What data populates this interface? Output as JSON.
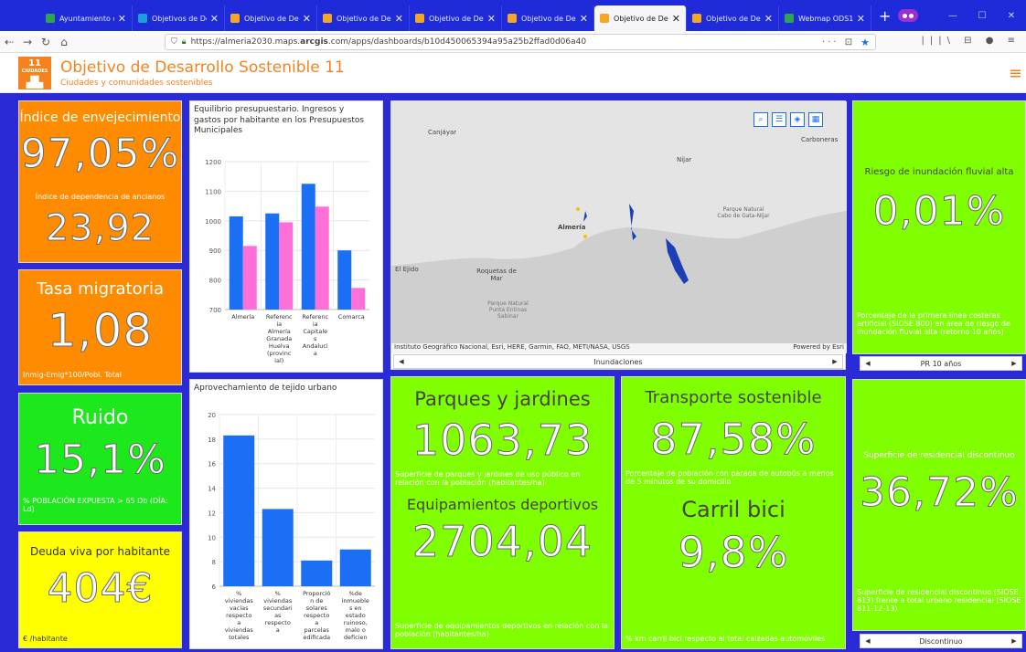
{
  "browser": {
    "tabs": [
      {
        "label": "Ayuntamiento d",
        "icon_color": "#2ea44f",
        "active": false
      },
      {
        "label": "Objetivos de De",
        "icon_color": "#1a9fd9",
        "active": false
      },
      {
        "label": "Objetivo de Des",
        "icon_color": "#f5a623",
        "active": false
      },
      {
        "label": "Objetivo de Des",
        "icon_color": "#f5a623",
        "active": false
      },
      {
        "label": "Objetivo de Des",
        "icon_color": "#f5a623",
        "active": false
      },
      {
        "label": "Objetivo de Des",
        "icon_color": "#f5a623",
        "active": false
      },
      {
        "label": "Objetivo de Des",
        "icon_color": "#f5a623",
        "active": true
      },
      {
        "label": "Objetivo de Des",
        "icon_color": "#f5a623",
        "active": false
      },
      {
        "label": "Webmap ODS1",
        "icon_color": "#2ea44f",
        "active": false
      }
    ],
    "url_prefix": "https://almeria2030.maps.",
    "url_bold": "arcgis",
    "url_suffix": ".com/apps/dashboards/b10d450065394a95a25b2ffad0d06a40",
    "page_actions": "··· ⊡",
    "right_icons": "|||\\ ⊟ ● ≡"
  },
  "header": {
    "title": "Objetivo de Desarrollo Sostenible 11",
    "subtitle": "Ciudades y comunidades sostenibles",
    "logo_num": "11",
    "logo_text": "CIUDADES"
  },
  "indicators": {
    "envejecimiento": {
      "title": "Índice de envejecimiento",
      "value": "97,05%",
      "sub_title": "Índice de dependencia de ancianos",
      "sub_value": "23,92"
    },
    "migratoria": {
      "title": "Tasa migratoria",
      "value": "1,08",
      "note": "Inmig-Emig*100/Pobl. Total"
    },
    "ruido": {
      "title": "Ruido",
      "value": "15,1%",
      "note": "% POBLACIÓN EXPUESTA > 65 Db (DÍA: Ld)"
    },
    "deuda": {
      "title": "Deuda viva por habitante",
      "value": "404€",
      "note": "€ /habitante"
    },
    "parques": {
      "title": "Parques y jardines",
      "value": "1063,73",
      "note": "Superficie de parques y jardines de uso público en relación con la población (habitantes/ha)"
    },
    "equipamientos": {
      "title": "Equipamientos deportivos",
      "value": "2704,04",
      "note": "Superficie de equipamientos deportivos en relación con la población (habitantes/ha)"
    },
    "transporte": {
      "title": "Transporte sostenible",
      "value": "87,58%",
      "note": "Porcentaje de población con parada de autobús a menos de 5 minutos de su domicilio"
    },
    "carril": {
      "title": "Carril bici",
      "value": "9,8%",
      "note": "% km carril bici respecto al total calzadas automóviles"
    },
    "inundacion": {
      "title": "Riesgo de inundación fluvial alta",
      "value": "0,01%",
      "note": "Porcentaje de la primera línea costeras artificial (SIOSE 800) en área de riesgo de inundación fluvial alta (retorno 10 años)",
      "selector": "PR 10 años"
    },
    "residencial": {
      "title": "Superficie de residencial discontinuo",
      "value": "36,72%",
      "note": "Superficie de residencial discontinuo (SIOSE 813) frente a total urbano residencial (SIOSE 811-12-13)",
      "selector": "Discontinuo"
    }
  },
  "map": {
    "labels": {
      "canjayar": "Canjáyar",
      "nijar": "Níjar",
      "carboneras": "Carboneras",
      "almeria": "Almería",
      "elejido": "El Ejido",
      "roquetas": "Roquetas de Mar",
      "parque": "Parque Natural Cabo de Gata-Níjar",
      "parque2": "Parque Natural Punta Entinas Sabinar"
    },
    "attribution": "Instituto Geográfico Nacional, Esri, HERE, Garmin, FAO, METI/NASA, USGS",
    "powered": "Powered by Esri",
    "selector": "Inundaciones"
  },
  "chart_data": [
    {
      "type": "bar",
      "title": "Equilibrio presupuestario. Ingresos y gastos por habitante en los Presupuestos Municipales",
      "categories": [
        "Almería",
        "Referencia Almería Granada Huelva (provincial)",
        "Referencia Capitales Andalucía",
        "Comarca"
      ],
      "category_lines": [
        [
          "Almería"
        ],
        [
          "Referenc",
          "ia",
          "Almería",
          "Granada",
          "Huelva",
          "(provinc",
          "ial)"
        ],
        [
          "Referenc",
          "ia",
          "Capitale",
          "s",
          "Andaluci",
          "a"
        ],
        [
          "Comarca"
        ]
      ],
      "series": [
        {
          "color": "#1a6ff5",
          "values": [
            1015,
            1025,
            1125,
            900
          ]
        },
        {
          "color": "#ff6fd8",
          "values": [
            915,
            995,
            1048,
            773
          ]
        }
      ],
      "ylim": [
        700,
        1200
      ],
      "yticks": [
        700,
        800,
        900,
        1000,
        1100,
        1200
      ],
      "grid": true
    },
    {
      "type": "bar",
      "title": "Aprovechamiento de tejido urbano",
      "categories": [
        "% viviendas vacías respecto a viviendas totales",
        "% viviendas secundarias respecto a",
        "Proporción de solares respecto a parcelas edificadas",
        "%de inmuebles en estado ruinoso, malo o deficiente"
      ],
      "category_lines": [
        [
          "%",
          "viviendas",
          "vacías",
          "respecto",
          "a",
          "viviendas",
          "totales"
        ],
        [
          "%",
          "viviendas",
          "secundari",
          "as",
          "respecto",
          "a"
        ],
        [
          "Proporció",
          "n de",
          "solares",
          "respecto",
          "a",
          "parcelas",
          "edificada"
        ],
        [
          "%de",
          "inmueble",
          "s en",
          "estado",
          "ruinoso,",
          "malo o",
          "deficien"
        ]
      ],
      "series": [
        {
          "color": "#1a6ff5",
          "values": [
            18.3,
            12.3,
            8.1,
            9.0
          ]
        }
      ],
      "ylim": [
        6,
        20
      ],
      "yticks": [
        6,
        8,
        10,
        12,
        14,
        16,
        18,
        20
      ],
      "grid": true
    }
  ]
}
